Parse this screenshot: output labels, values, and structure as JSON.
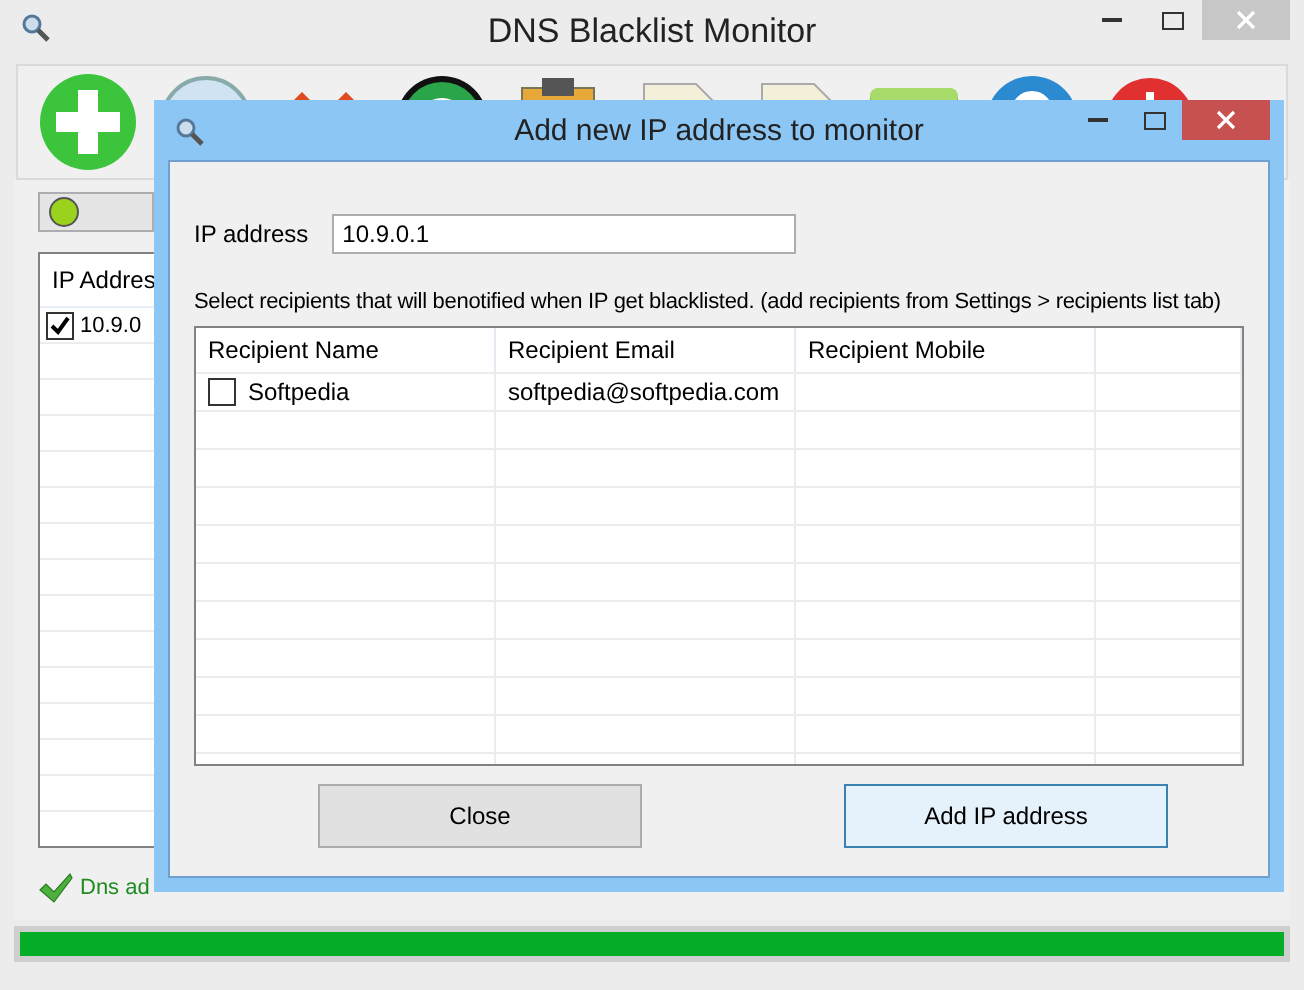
{
  "window": {
    "title": "DNS Blacklist Monitor"
  },
  "toolbar": [
    {
      "kind": "add"
    },
    {
      "kind": "search"
    },
    {
      "kind": "delete"
    },
    {
      "kind": "refresh"
    },
    {
      "kind": "clipboard"
    },
    {
      "kind": "document"
    },
    {
      "kind": "document"
    },
    {
      "kind": "database"
    },
    {
      "kind": "help"
    },
    {
      "kind": "power"
    }
  ],
  "monitor_list": {
    "columns": [
      "IP Addres"
    ],
    "rows": [
      {
        "ip": "10.9.0",
        "checked": true
      }
    ]
  },
  "status": [
    {
      "text": "Dns ad"
    }
  ],
  "progress": {
    "level": 1
  },
  "dialog": {
    "title": "Add new IP address to monitor",
    "ip_label": "IP address",
    "ip_value": "10.9.0.1",
    "instruction": "Select recipients that will benotified when IP get blacklisted. (add recipients from Settings > recipients list tab)",
    "columns": [
      "Recipient Name",
      "Recipient Email",
      "Recipient Mobile"
    ],
    "rows": [
      {
        "name": "Softpedia",
        "email": "softpedia@softpedia.com",
        "checked": false
      }
    ],
    "buttons": [
      {
        "label": "Close",
        "focused": false
      },
      {
        "label": "Add IP address",
        "focused": true
      }
    ]
  }
}
